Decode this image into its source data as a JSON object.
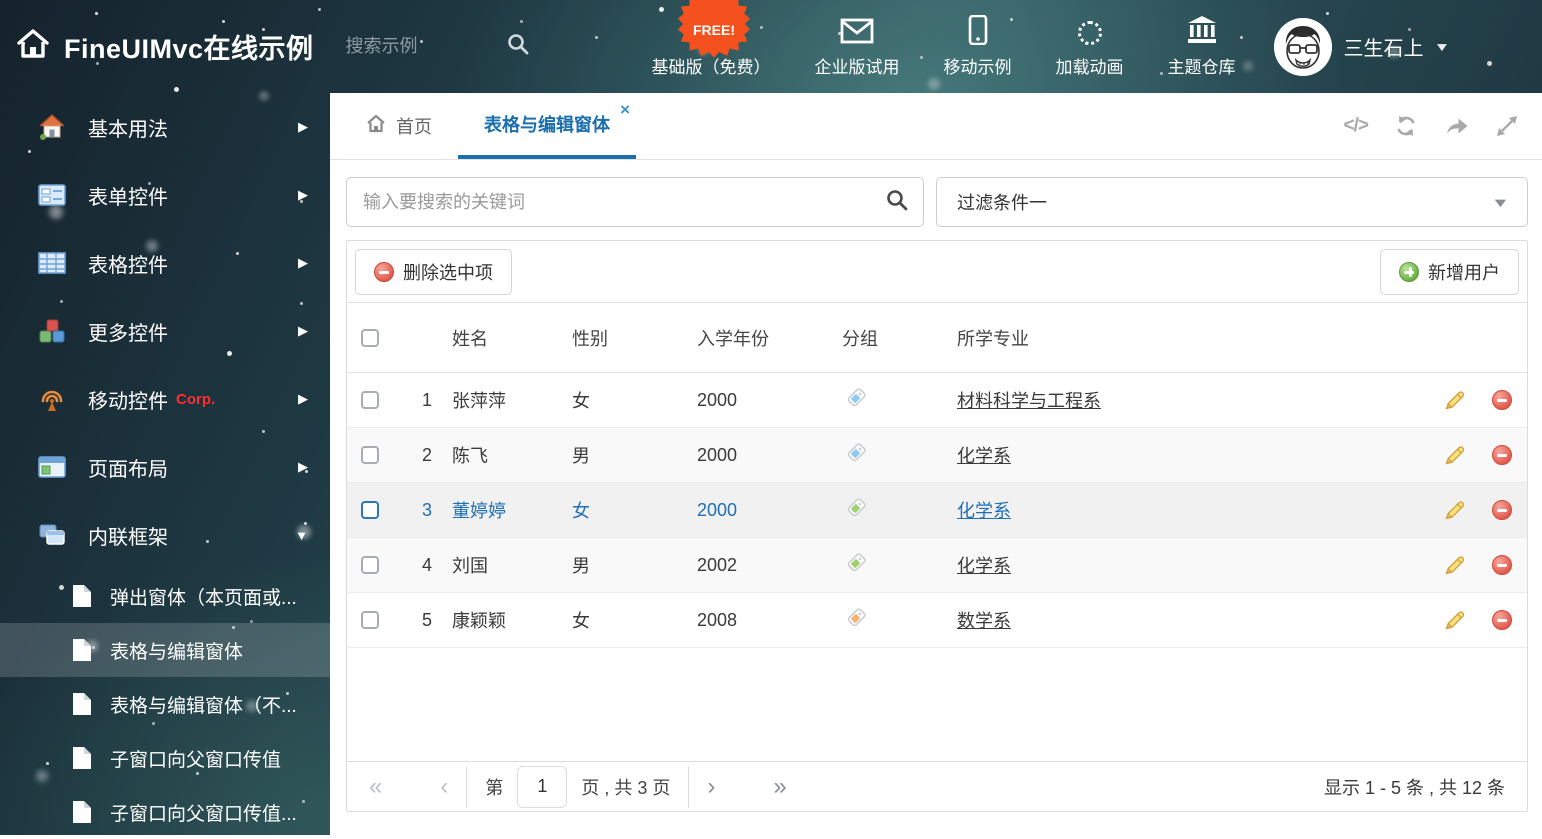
{
  "icons": {
    "caret_down": "▼",
    "caret_right": "▶",
    "tab_close": "×",
    "code_glyph": "</>",
    "pag_first": "«",
    "pag_prev": "‹",
    "pag_next": "›",
    "pag_last": "»"
  },
  "colors": {
    "accent_blue": "#1c6fad",
    "free_badge": "#f4511e",
    "delete_red": "#e2574a",
    "add_green": "#67ae41"
  },
  "header": {
    "title": "FineUIMvc在线示例",
    "search_placeholder": "搜索示例",
    "free_badge": "FREE!",
    "nav": [
      {
        "icon": "download-icon",
        "label": "基础版（免费）"
      },
      {
        "icon": "envelope-icon",
        "label": "企业版试用"
      },
      {
        "icon": "mobile-icon",
        "label": "移动示例"
      },
      {
        "icon": "spinner-icon",
        "label": "加载动画"
      },
      {
        "icon": "bank-icon",
        "label": "主题仓库"
      }
    ],
    "user_name": "三生石上"
  },
  "sidebar": {
    "items": [
      {
        "label": "基本用法"
      },
      {
        "label": "表单控件"
      },
      {
        "label": "表格控件"
      },
      {
        "label": "更多控件"
      },
      {
        "label": "移动控件",
        "badge": "Corp."
      },
      {
        "label": "页面布局"
      },
      {
        "label": "内联框架"
      }
    ],
    "subitems": [
      {
        "label": "弹出窗体（本页面或..."
      },
      {
        "label": "表格与编辑窗体"
      },
      {
        "label": "表格与编辑窗体（不..."
      },
      {
        "label": "子窗口向父窗口传值"
      },
      {
        "label": "子窗口向父窗口传值..."
      }
    ]
  },
  "main": {
    "tabs": [
      {
        "label": "首页"
      },
      {
        "label": "表格与编辑窗体"
      }
    ],
    "search_placeholder": "输入要搜索的关键词",
    "filter_value": "过滤条件一"
  },
  "grid": {
    "delete_selected_label": "删除选中项",
    "add_user_label": "新增用户",
    "columns": [
      "姓名",
      "性别",
      "入学年份",
      "分组",
      "所学专业"
    ],
    "rows": [
      {
        "num": "1",
        "name": "张萍萍",
        "gender": "女",
        "year": "2000",
        "tag_color": "#8ecaf2",
        "major": "材料科学与工程系"
      },
      {
        "num": "2",
        "name": "陈飞",
        "gender": "男",
        "year": "2000",
        "tag_color": "#8ecaf2",
        "major": "化学系"
      },
      {
        "num": "3",
        "name": "董婷婷",
        "gender": "女",
        "year": "2000",
        "tag_color": "#a3d06e",
        "major": "化学系"
      },
      {
        "num": "4",
        "name": "刘国",
        "gender": "男",
        "year": "2002",
        "tag_color": "#a3d06e",
        "major": "化学系"
      },
      {
        "num": "5",
        "name": "康颖颖",
        "gender": "女",
        "year": "2008",
        "tag_color": "#f6b26f",
        "major": "数学系"
      }
    ]
  },
  "pagination": {
    "page_prefix": "第",
    "page_value": "1",
    "page_suffix": "页 , 共 3 页",
    "summary": "显示 1 - 5 条 , 共 12 条"
  }
}
